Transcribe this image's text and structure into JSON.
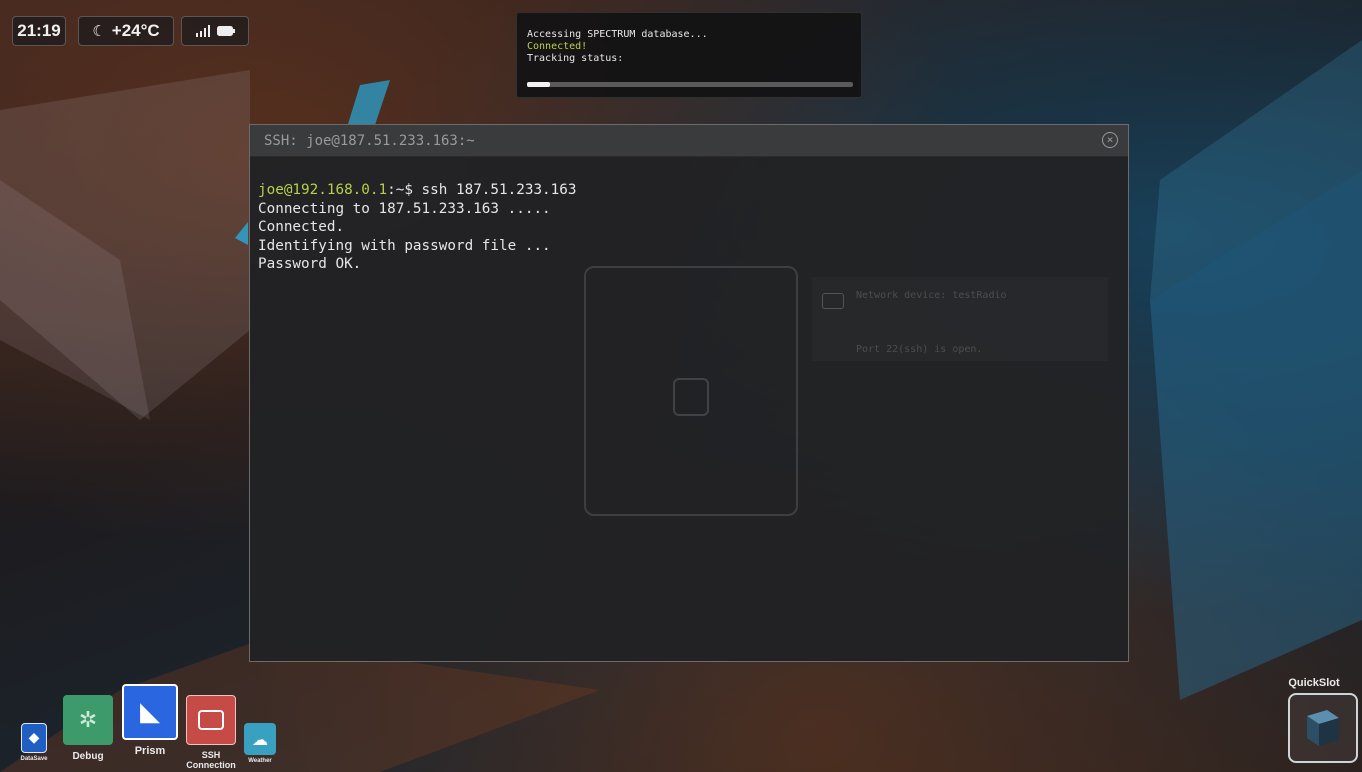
{
  "status_bar": {
    "time": "21:19",
    "weather": "+24°C"
  },
  "notification": {
    "line1": "Accessing SPECTRUM database...",
    "line2": "Connected!",
    "line3": "Tracking status:",
    "progress": 0.07
  },
  "ssh_window": {
    "title": "SSH: joe@187.51.233.163:~",
    "prompt_user": "joe@192.168.0.1",
    "prompt_suffix": ":~$ ssh 187.51.233.163",
    "lines": [
      "Connecting to 187.51.233.163 .....",
      "Connected.",
      "Identifying with password file ...",
      "Password OK."
    ],
    "ghost_device": {
      "title": "Network device: testRadio",
      "footer": "Port 22(ssh) is open."
    }
  },
  "dock": {
    "items": [
      {
        "label": "DataSave",
        "color": "#1f5fc4"
      },
      {
        "label": "Debug",
        "color": "#3d9a6a"
      },
      {
        "label": "Prism",
        "color": "#2a66e0"
      },
      {
        "label": "SSH Connection",
        "color": "#c64a45"
      },
      {
        "label": "Weather",
        "color": "#3aa0c0"
      }
    ],
    "quickslot": "QuickSlot"
  }
}
